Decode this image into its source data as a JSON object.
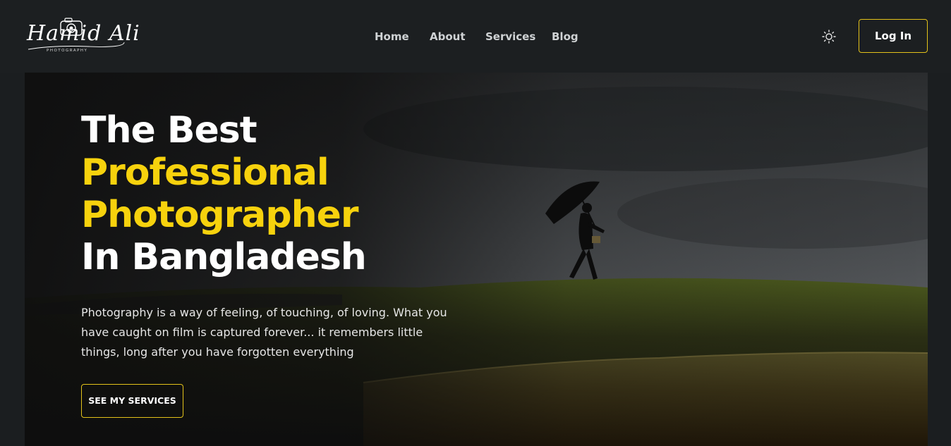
{
  "brand": {
    "logo_script": "Hamid Ali",
    "logo_subtitle": "PHOTOGRAPHY"
  },
  "nav": {
    "items": [
      {
        "label": "Home"
      },
      {
        "label": "About"
      },
      {
        "label": "Services"
      },
      {
        "label": "Blog"
      }
    ]
  },
  "header": {
    "theme_icon": "sun-icon",
    "login_label": "Log In"
  },
  "hero": {
    "title_line1": "The Best",
    "title_line2": "Professional",
    "title_line3": "Photographer",
    "title_line4": "In Bangladesh",
    "description": "Photography is a way of feeling, of touching, of loving. What you have caught on film is captured forever... it remembers little things, long after you have forgotten everything",
    "cta_label": "SEE MY SERVICES"
  },
  "colors": {
    "accent": "#f7d20d",
    "header_bg": "#1c1f21",
    "button_border": "#e3c21a"
  }
}
